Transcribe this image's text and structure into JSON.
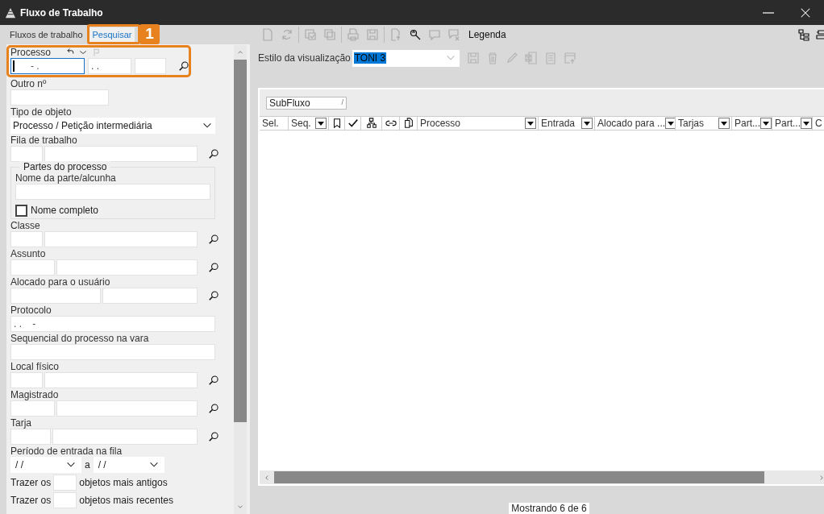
{
  "window": {
    "title": "Fluxo de Trabalho"
  },
  "tabs": [
    {
      "label": "Fluxos de trabalho",
      "selected": false
    },
    {
      "label": "Pesquisar",
      "selected": true
    }
  ],
  "callout": {
    "label": "1"
  },
  "form": [
    {
      "kind": "processo",
      "label": "Processo",
      "values": [
        "- .",
        ". ."
      ]
    },
    {
      "kind": "text",
      "label": "Outro nº"
    },
    {
      "kind": "select",
      "label": "Tipo de objeto",
      "value": "Processo / Petição intermediária"
    },
    {
      "kind": "lookup",
      "label": "Fila de trabalho"
    },
    {
      "kind": "group",
      "legend": "Partes do processo",
      "label": "Nome da parte/alcunha",
      "checkbox": {
        "label": "Nome completo",
        "checked": false
      }
    },
    {
      "kind": "lookup",
      "label": "Classe"
    },
    {
      "kind": "lookup",
      "label": "Assunto"
    },
    {
      "kind": "lookup",
      "label": "Alocado para o usuário"
    },
    {
      "kind": "text",
      "label": "Protocolo",
      "value": ". .    -"
    },
    {
      "kind": "text",
      "label": "Sequencial do processo na vara"
    },
    {
      "kind": "lookup",
      "label": "Local físico"
    },
    {
      "kind": "lookup",
      "label": "Magistrado"
    },
    {
      "kind": "lookup",
      "label": "Tarja"
    },
    {
      "kind": "dates",
      "label": "Período de entrada na fila",
      "from": "/ /",
      "sep": "a",
      "to": "/ /"
    },
    {
      "kind": "count",
      "before": "Trazer os",
      "after": "objetos mais antigos"
    },
    {
      "kind": "count",
      "before": "Trazer os",
      "after": "objetos mais recentes"
    }
  ],
  "toolbar": [
    {
      "kind": "button",
      "disabled": true
    },
    {
      "kind": "button",
      "disabled": true
    },
    {
      "kind": "separator"
    },
    {
      "kind": "button",
      "disabled": true
    },
    {
      "kind": "button",
      "disabled": true
    },
    {
      "kind": "separator"
    },
    {
      "kind": "button",
      "disabled": true
    },
    {
      "kind": "button",
      "disabled": true
    },
    {
      "kind": "separator"
    },
    {
      "kind": "button",
      "disabled": true
    },
    {
      "kind": "button",
      "disabled": false
    },
    {
      "kind": "button",
      "disabled": true
    },
    {
      "kind": "button",
      "disabled": true
    },
    {
      "kind": "text",
      "label": "Legenda"
    }
  ],
  "view_style": {
    "label": "Estilo da visualização",
    "value": "TONI 3"
  },
  "view_actions": [
    {
      "disabled": true
    },
    {
      "disabled": true
    },
    {
      "disabled": true
    },
    {
      "disabled": true
    },
    {
      "disabled": true
    },
    {
      "disabled": true
    }
  ],
  "group_by": {
    "label": "SubFluxo",
    "sort": "/"
  },
  "columns": [
    {
      "kind": "text",
      "label": "Sel.",
      "filter": false
    },
    {
      "kind": "text",
      "label": "Seq.",
      "filter": true
    },
    {
      "kind": "icon"
    },
    {
      "kind": "icon"
    },
    {
      "kind": "icon"
    },
    {
      "kind": "icon"
    },
    {
      "kind": "icon"
    },
    {
      "kind": "text",
      "label": "Processo",
      "filter": true
    },
    {
      "kind": "text",
      "label": "Entrada",
      "filter": true
    },
    {
      "kind": "text",
      "label": "Alocado para ...",
      "filter": true
    },
    {
      "kind": "text",
      "label": "Tarjas",
      "filter": true
    },
    {
      "kind": "text",
      "label": "Part...",
      "filter": true
    },
    {
      "kind": "text",
      "label": "Part...",
      "filter": true
    },
    {
      "kind": "text",
      "label": "C",
      "filter": false
    }
  ],
  "status": "Mostrando 6 de 6"
}
